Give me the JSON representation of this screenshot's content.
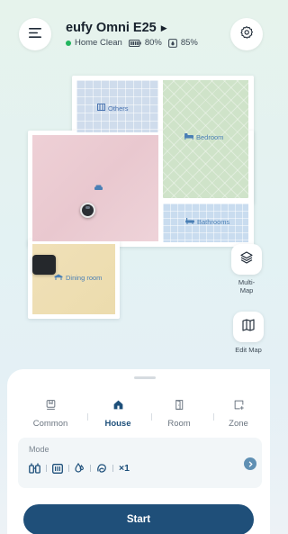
{
  "header": {
    "device_name": "eufy Omni E25",
    "title_arrow": "▶",
    "status": "Home Clean",
    "battery": "80%",
    "water": "85%",
    "menu_icon": "menu-icon",
    "settings_icon": "settings-icon"
  },
  "map": {
    "rooms": {
      "others": "Others",
      "bedroom": "Bedroom",
      "main": "",
      "bathrooms": "Bathrooms",
      "dining": "Dining room"
    },
    "colors": {
      "others": "#cfdcec",
      "bedroom": "#cfe3c9",
      "main": "#ecccd3",
      "bathrooms": "#c9dcef",
      "dining": "#eedeb1"
    },
    "tools": {
      "multi_map_label": "Multi-Map",
      "edit_map_label": "Edit Map"
    }
  },
  "tabs": [
    {
      "label": "Common",
      "icon": "common-icon",
      "active": false
    },
    {
      "label": "House",
      "icon": "house-icon",
      "active": true
    },
    {
      "label": "Room",
      "icon": "room-icon",
      "active": false
    },
    {
      "label": "Zone",
      "icon": "zone-icon",
      "active": false
    }
  ],
  "mode": {
    "title": "Mode",
    "icons": [
      "vacuum-mop-icon",
      "suction-icon",
      "water-level-icon",
      "cleaning-route-icon"
    ],
    "passes": "×1"
  },
  "start_button": {
    "label": "Start"
  },
  "theme": {
    "accent": "#1f4f79",
    "status_dot": "#22b55e",
    "active_tab": "#1d4f7a"
  }
}
